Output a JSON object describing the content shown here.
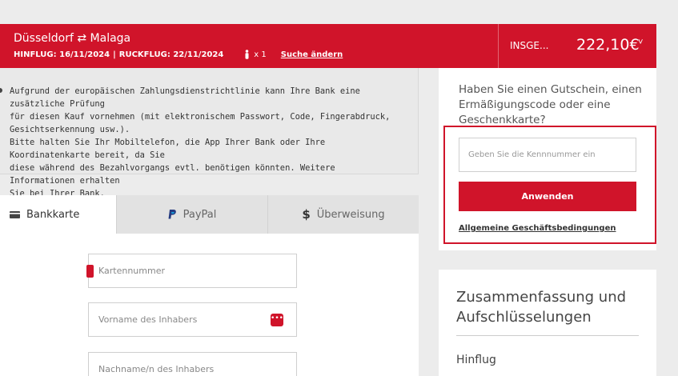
{
  "header": {
    "route_from": "Düsseldorf",
    "route_sep": "⇄",
    "route_to": "Malaga",
    "outbound": "HINFLUG: 16/11/2024",
    "sep": "|",
    "return": "RUCKFLUG: 22/11/2024",
    "passengers": "x 1",
    "change_search": "Suche ändern",
    "total_label": "INSGE...",
    "total_amount": "222,10€",
    "total_chevron": "˅"
  },
  "info": {
    "text": "Aufgrund der europäischen Zahlungsdienstrichtlinie kann Ihre Bank eine zusätzliche Prüfung\nfür diesen Kauf vornehmen (mit elektronischem Passwort, Code, Fingerabdruck,\nGesichtserkennung usw.).\nBitte halten Sie Ihr Mobiltelefon, die App Ihrer Bank oder Ihre Koordinatenkarte bereit, da Sie\ndiese während des Bezahlvorgangs evtl. benötigen könnten. Weitere Informationen erhalten\nSie bei Ihrer Bank."
  },
  "tabs": [
    {
      "label": "Bankkarte",
      "icon": "card-icon"
    },
    {
      "label": "PayPal",
      "icon": "paypal-icon"
    },
    {
      "label": "Überweisung",
      "icon": "dollar-icon"
    }
  ],
  "form": {
    "card_number_placeholder": "Kartennummer",
    "holder_first_placeholder": "Vorname des Inhabers",
    "holder_last_placeholder": "Nachname/n des Inhabers"
  },
  "voucher": {
    "title": "Haben Sie einen Gutschein, einen Ermäßigungscode oder eine Geschenkkarte?",
    "input_placeholder": "Geben Sie die Kennnummer ein",
    "apply_label": "Anwenden",
    "terms_label": "Allgemeine Geschäftsbedingungen"
  },
  "summary": {
    "title": "Zusammenfassung und Aufschlüsselungen",
    "outbound_label": "Hinflug"
  },
  "colors": {
    "brand_red": "#d0142a"
  }
}
